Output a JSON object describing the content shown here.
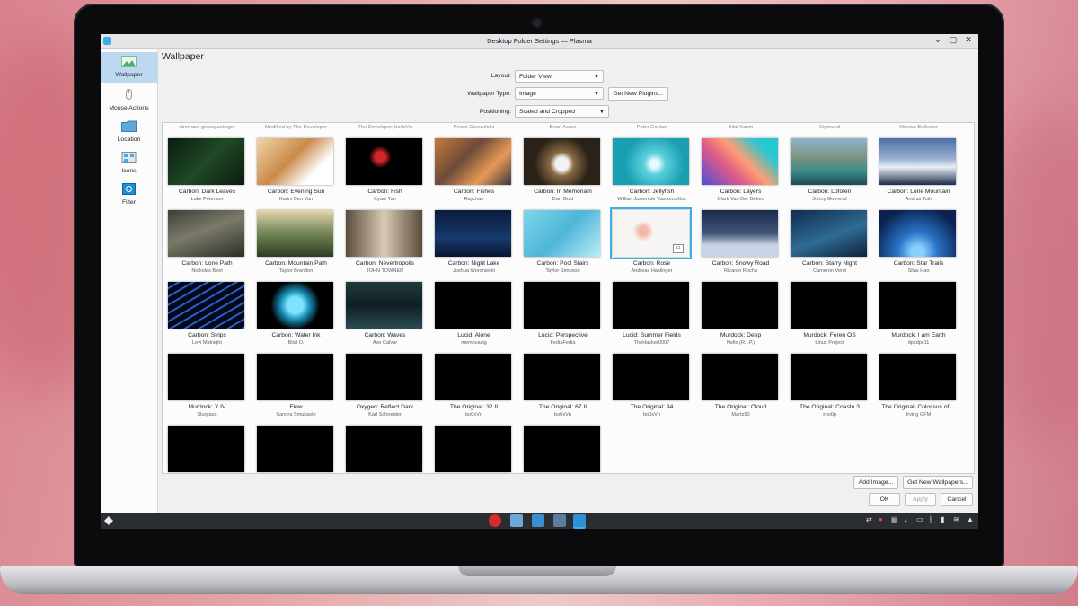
{
  "window": {
    "title": "Desktop Folder Settings — Plasma",
    "minimize": "⌄",
    "maximize": "▢",
    "close": "✕"
  },
  "sidebar": {
    "items": [
      {
        "label": "Wallpaper",
        "icon": "wallpaper-icon"
      },
      {
        "label": "Mouse Actions",
        "icon": "mouse-icon"
      },
      {
        "label": "Location",
        "icon": "folder-icon"
      },
      {
        "label": "Icons",
        "icon": "icons-icon"
      },
      {
        "label": "Filter",
        "icon": "filter-icon"
      }
    ]
  },
  "main": {
    "heading": "Wallpaper"
  },
  "form": {
    "layout_label": "Layout:",
    "layout_value": "Folder View",
    "type_label": "Wallpaper Type:",
    "type_value": "Image",
    "plugins_button": "Get New Plugins...",
    "positioning_label": "Positioning:",
    "positioning_value": "Scaled and Cropped"
  },
  "authors_top": [
    "eberhard grossgasteiger",
    "Modified by The Developer",
    "The Developer, bo0xVn",
    "Pewel Czerwiński",
    "Brian Asare",
    "Peter Conlan",
    "Bilal Karim",
    "Sigmund",
    "Mónica Ballester"
  ],
  "wallpapers": [
    {
      "name": "Carbon: Dark Leaves",
      "author": "Luke Peterson",
      "bg": "linear-gradient(135deg,#0c1a10,#1f4a25 50%,#0b1a0e)"
    },
    {
      "name": "Carbon: Evening Sun",
      "author": "Karim Ben Van",
      "bg": "linear-gradient(135deg,#f2d4a8,#c98a4a 45%,#fff 75%)"
    },
    {
      "name": "Carbon: Fish",
      "author": "Kyaw Tun",
      "bg": "radial-gradient(circle at 45% 40%,#d2262a 0 10%,#000 22%)"
    },
    {
      "name": "Carbon: Fishes",
      "author": "Raychan",
      "bg": "linear-gradient(135deg,#c77a3b,#6b4b3a 40%,#e89a55 70%,#3a3640)"
    },
    {
      "name": "Carbon: In Memoriam",
      "author": "Dan Gold",
      "bg": "radial-gradient(circle at 50% 55%,#f2f2f2 0 14%,#8a6a45 26%,#2a2118 60%)"
    },
    {
      "name": "Carbon: Jellyfish",
      "author": "Willian Justen de Vasconcellos",
      "bg": "radial-gradient(circle at 55% 55%,#e8fbff 0 8%,#5bd0dc 22%,#1a9fb2 60%)"
    },
    {
      "name": "Carbon: Layers",
      "author": "Clark Van Der Beken",
      "bg": "linear-gradient(45deg,#4b4dd6,#e05a8a 35%,#ff9e73 55%,#28c8d0 80%)"
    },
    {
      "name": "Carbon: Lofoten",
      "author": "Johny Goerend",
      "bg": "linear-gradient(180deg,#8fb6cf,#7e9480 40%,#3a8c8a 70%,#1d4b56)"
    },
    {
      "name": "Carbon: Lone Mountain",
      "author": "Andras Toth",
      "bg": "linear-gradient(180deg,#4c6ea8,#9cb3d1 45%,#e9eef5 62%,#1c2c4a)"
    },
    {
      "name": "Carbon: Lone Path",
      "author": "Nicholas Beel",
      "bg": "linear-gradient(160deg,#3d3f35,#7b7a6a 45%,#2b2f26)"
    },
    {
      "name": "Carbon: Mountain Path",
      "author": "Taylor Brandon",
      "bg": "linear-gradient(180deg,#e8d7b0,#7a8c5c 45%,#2e3b22)"
    },
    {
      "name": "Carbon: Nevertropolis",
      "author": "JOHN TOWNER",
      "bg": "linear-gradient(90deg,#5a4a3c,#d9cbb5 50%,#5a4a3c)"
    },
    {
      "name": "Carbon: Night Lake",
      "author": "Joshua Woroniecki",
      "bg": "linear-gradient(180deg,#091a3a,#173a6e 60%,#0a1530)"
    },
    {
      "name": "Carbon: Pool Stairs",
      "author": "Taylor Simpson",
      "bg": "linear-gradient(135deg,#7fd6ea,#4fb6d8 50%,#b8ecf5)"
    },
    {
      "name": "Carbon: Rose",
      "author": "Andreas Haslinger",
      "bg": "radial-gradient(circle at 40% 45%,#f2b9a7 0 8%,#f7f5f3 20%)"
    },
    {
      "name": "Carbon: Snowy Road",
      "author": "Ricardo Rocha",
      "bg": "linear-gradient(180deg,#1a2a4a,#43557a 50%,#c9d3e3 75%)"
    },
    {
      "name": "Carbon: Starry Night",
      "author": "Cameron Venti",
      "bg": "linear-gradient(160deg,#0f2c4c,#2f6b93 55%,#0e2238)"
    },
    {
      "name": "Carbon: Star Trails",
      "author": "Silas Hao",
      "bg": "radial-gradient(circle at 50% 90%,#8ad0ff 0 10%,#2a74c7 35%,#0b2250 80%)"
    },
    {
      "name": "Carbon: Strips",
      "author": "Levi Midnight",
      "bg": "repeating-linear-gradient(150deg,#04081a 0 5px,#3a7cff 6px,#04081a 8px)"
    },
    {
      "name": "Carbon: Water Ink",
      "author": "Bilal O.",
      "bg": "radial-gradient(circle at 50% 50%,#7fe0ff 0 18%,#1a8fb8 32%,#000 55%)"
    },
    {
      "name": "Carbon: Waves",
      "author": "Ave Calvar",
      "bg": "linear-gradient(180deg,#1f3a40,#0e1e22 50%,#2a4a52)"
    },
    {
      "name": "Lucid: Alone",
      "author": "memovasig",
      "bg": "#000"
    },
    {
      "name": "Lucid: Perspective",
      "author": "FediaFedia",
      "bg": "#000"
    },
    {
      "name": "Lucid: Summer Fields",
      "author": "TheHacker0007",
      "bg": "#000"
    },
    {
      "name": "Murdock: Deep",
      "author": "Nello (R.I.P.)",
      "bg": "#000"
    },
    {
      "name": "Murdock: Feren OS",
      "author": "Linux Project",
      "bg": "#000"
    },
    {
      "name": "Murdock: I am Earth",
      "author": "dpcdpc11",
      "bg": "#000"
    },
    {
      "name": "Murdock: X IV",
      "author": "Slurpaza",
      "bg": "#000"
    },
    {
      "name": "Flow",
      "author": "Sandra Smukaste",
      "bg": "#000"
    },
    {
      "name": "Oxygen: Reflect Dark",
      "author": "Karl Schneider",
      "bg": "#000"
    },
    {
      "name": "The Original: 32 II",
      "author": "bo0xVn",
      "bg": "#000"
    },
    {
      "name": "The Original: 67 II",
      "author": "bo0xVn",
      "bg": "#000"
    },
    {
      "name": "The Original: 94",
      "author": "bo0xVn",
      "bg": "#000"
    },
    {
      "name": "The Original: Cloud",
      "author": "Martz90",
      "bg": "#000"
    },
    {
      "name": "The Original: Coasto 3",
      "author": "xho0p",
      "bg": "#000"
    },
    {
      "name": "The Original: Colossus of ...",
      "author": "Irving GFM",
      "bg": "#000"
    },
    {
      "name": "",
      "author": "",
      "bg": "#000"
    },
    {
      "name": "",
      "author": "",
      "bg": "#000"
    },
    {
      "name": "",
      "author": "",
      "bg": "#000"
    },
    {
      "name": "",
      "author": "",
      "bg": "#000"
    },
    {
      "name": "",
      "author": "",
      "bg": "#000"
    }
  ],
  "selected_index": 14,
  "buttons": {
    "add_image": "Add Image...",
    "get_wallpapers": "Get New Wallpapers...",
    "ok": "OK",
    "apply": "Apply",
    "cancel": "Cancel"
  },
  "taskbar": {
    "tasks": [
      "vivaldi-icon",
      "file-manager-icon",
      "settings-icon",
      "system-monitor-icon",
      "desktop-settings-icon"
    ]
  },
  "colors": {
    "accent": "#3daee9",
    "taskbar": "#2b2e31"
  }
}
